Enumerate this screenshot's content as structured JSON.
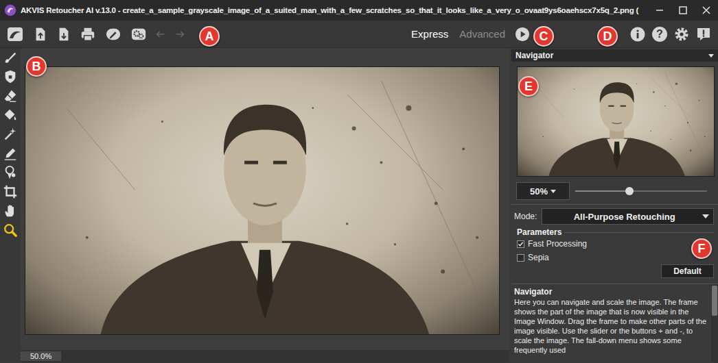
{
  "window": {
    "title": "AKVIS Retoucher AI v.13.0 - create_a_sample_grayscale_image_of_a_suited_man_with_a_few_scratches_so_that_it_looks_like_a_very_o_ovaat9ys6oaehscx7x5q_2.png ("
  },
  "toolbar": {
    "history": [
      {
        "kind": "back",
        "disabled": true
      },
      {
        "kind": "forward",
        "disabled": true
      }
    ],
    "modes": [
      {
        "label": "Express",
        "selected": true
      },
      {
        "label": "Advanced",
        "selected": false
      }
    ],
    "help_icon": "?"
  },
  "tools": [
    {
      "kind": "brush",
      "selected": false
    },
    {
      "kind": "protect",
      "selected": false
    },
    {
      "kind": "eraser",
      "selected": false
    },
    {
      "kind": "bucket",
      "selected": false
    },
    {
      "kind": "wand",
      "selected": false
    },
    {
      "kind": "pencil",
      "selected": false
    },
    {
      "kind": "stamp",
      "selected": false
    },
    {
      "kind": "crop",
      "selected": false
    },
    {
      "kind": "hand",
      "selected": false
    },
    {
      "kind": "zoom",
      "selected": true
    }
  ],
  "navigator": {
    "title": "Navigator",
    "zoom": "50%",
    "level": 0.41
  },
  "mode": {
    "label": "Mode:",
    "value": "All-Purpose Retouching"
  },
  "parameters": {
    "title": "Parameters",
    "options": [
      {
        "label": "Fast Processing",
        "checked": true
      },
      {
        "label": "Sepia",
        "checked": false
      }
    ],
    "default_button": "Default"
  },
  "help": {
    "title": "Navigator",
    "text": "Here you can navigate and scale the image. The frame shows the part of the image that is now visible in the Image Window. Drag the frame to make other parts of the image visible. Use the slider or the buttons + and -, to scale the image. The fall-down menu shows some frequently used"
  },
  "status_bar": {
    "zoom": "50.0%"
  },
  "annotations": [
    {
      "label": "A"
    },
    {
      "label": "B"
    },
    {
      "label": "C"
    },
    {
      "label": "D"
    },
    {
      "label": "E"
    },
    {
      "label": "F"
    }
  ]
}
